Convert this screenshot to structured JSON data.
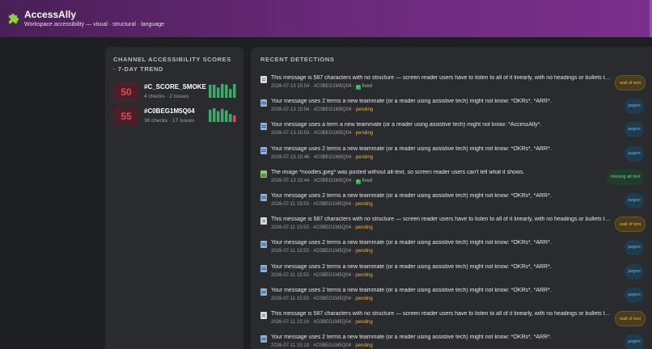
{
  "header": {
    "app_title": "AccessAlly",
    "subtitle": "Workspace accessibility — visual · structural · language",
    "logo_icon": "puzzle-piece-icon",
    "accent": "#6b2a7c"
  },
  "left_panel": {
    "title": "Channel accessibility scores · 7-day trend",
    "channels": [
      {
        "score": "50",
        "name": "#C_SCORE_SMOKE",
        "meta": "4 checks · 2 issues",
        "trend": [
          0.9,
          0.9,
          0.7,
          0.95,
          0.9,
          0.6,
          0.95
        ],
        "trend_colors": [
          "#3fa86a",
          "#3fa86a",
          "#3fa86a",
          "#3fa86a",
          "#3fa86a",
          "#3fa86a",
          "#3fa86a"
        ]
      },
      {
        "score": "55",
        "name": "#C0BEG1M5Q04",
        "meta": "38 checks · 17 issues",
        "trend": [
          0.85,
          0.95,
          0.75,
          0.9,
          0.8,
          0.55,
          0.45
        ],
        "trend_colors": [
          "#3fa86a",
          "#3fa86a",
          "#3fa86a",
          "#3fa86a",
          "#3fa86a",
          "#3fa86a",
          "#d94a5c"
        ]
      }
    ]
  },
  "right_panel": {
    "title": "Recent detections",
    "detections": [
      {
        "icon": "doc",
        "text": "This message is 587 characters with no structure — screen reader users have to listen to all of it linearly, with no headings or bullets to ...",
        "time": "2026-07-13 15:54",
        "channel": "#C0BEG1M5Q04",
        "status": "fixed",
        "tag": "wall of text",
        "tag_type": "wall"
      },
      {
        "icon": "msg",
        "text": "Your message uses 2 terms a new teammate (or a reader using assistive tech) might not know: *OKRs*, *ARR*.",
        "time": "2026-07-13 15:54",
        "channel": "#C0BEG1M5Q04",
        "status": "pending",
        "tag": "jargon",
        "tag_type": "jargon"
      },
      {
        "icon": "msg",
        "text": "Your message uses a term a new teammate (or a reader using assistive tech) might not know: *AccessAlly*.",
        "time": "2026-07-13 15:53",
        "channel": "#C0BEG1M5Q04",
        "status": "pending",
        "tag": "jargon",
        "tag_type": "jargon"
      },
      {
        "icon": "msg",
        "text": "Your message uses 2 terms a new teammate (or a reader using assistive tech) might not know: *OKRs*, *ARR*.",
        "time": "2026-07-13 15:46",
        "channel": "#C0BEG1M5Q04",
        "status": "pending",
        "tag": "jargon",
        "tag_type": "jargon"
      },
      {
        "icon": "img",
        "text": "The image *noodles.jpeg* was posted without alt-text, so screen reader users can't tell what it shows.",
        "time": "2026-07-13 15:44",
        "channel": "#C0BEG1M5Q04",
        "status": "fixed",
        "tag": "missing alt text",
        "tag_type": "alt"
      },
      {
        "icon": "msg",
        "text": "Your message uses 2 terms a new teammate (or a reader using assistive tech) might not know: *OKRs*, *ARR*.",
        "time": "2026-07-11 15:53",
        "channel": "#C0BEG1M5Q04",
        "status": "pending",
        "tag": "jargon",
        "tag_type": "jargon"
      },
      {
        "icon": "doc",
        "text": "This message is 587 characters with no structure — screen reader users have to listen to all of it linearly, with no headings or bullets to ...",
        "time": "2026-07-11 15:53",
        "channel": "#C0BEG1M5Q04",
        "status": "pending",
        "tag": "wall of text",
        "tag_type": "wall"
      },
      {
        "icon": "msg",
        "text": "Your message uses 2 terms a new teammate (or a reader using assistive tech) might not know: *OKRs*, *ARR*.",
        "time": "2026-07-11 15:53",
        "channel": "#C0BEG1M5Q04",
        "status": "pending",
        "tag": "jargon",
        "tag_type": "jargon"
      },
      {
        "icon": "msg",
        "text": "Your message uses 2 terms a new teammate (or a reader using assistive tech) might not know: *OKRs*, *ARR*.",
        "time": "2026-07-11 15:53",
        "channel": "#C0BEG1M5Q04",
        "status": "pending",
        "tag": "jargon",
        "tag_type": "jargon"
      },
      {
        "icon": "msg",
        "text": "Your message uses 2 terms a new teammate (or a reader using assistive tech) might not know: *OKRs*, *ARR*.",
        "time": "2026-07-11 15:53",
        "channel": "#C0BEG1M5Q04",
        "status": "pending",
        "tag": "jargon",
        "tag_type": "jargon"
      },
      {
        "icon": "doc",
        "text": "This message is 587 characters with no structure — screen reader users have to listen to all of it linearly, with no headings or bullets to ...",
        "time": "2026-07-11 15:19",
        "channel": "#C0BEG1M5Q04",
        "status": "pending",
        "tag": "wall of text",
        "tag_type": "wall"
      },
      {
        "icon": "msg",
        "text": "Your message uses 2 terms a new teammate (or a reader using assistive tech) might not know: *OKRs*, *ARR*.",
        "time": "2026-07-11 15:19",
        "channel": "#C0BEG1M5Q04",
        "status": "pending",
        "tag": "jargon",
        "tag_type": "jargon"
      }
    ]
  }
}
